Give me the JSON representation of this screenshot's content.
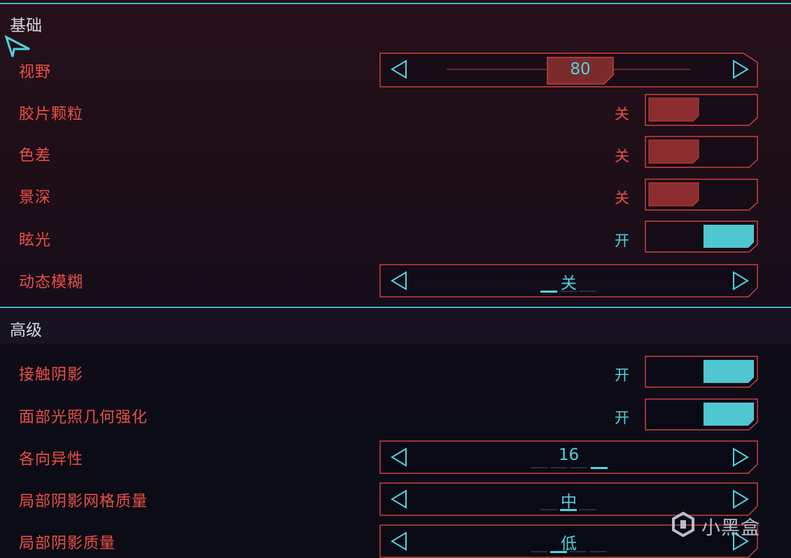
{
  "colors": {
    "accent_cyan": "#4fd3de",
    "accent_red": "#ea4f45",
    "off_fill": "#8c2c2f",
    "frame": "#c9403c"
  },
  "sections": {
    "basic": {
      "title": "基础"
    },
    "advanced": {
      "title": "高级"
    }
  },
  "settings": {
    "fov": {
      "label": "视野",
      "value": "80",
      "level_fraction": 0.45
    },
    "film_grain": {
      "label": "胶片颗粒",
      "state": "关",
      "on": false
    },
    "chromatic_aberration": {
      "label": "色差",
      "state": "关",
      "on": false
    },
    "depth_of_field": {
      "label": "景深",
      "state": "关",
      "on": false
    },
    "lens_flare": {
      "label": "眩光",
      "state": "开",
      "on": true
    },
    "motion_blur": {
      "label": "动态模糊",
      "value": "关",
      "option_count": 3,
      "selected_index": 0
    },
    "contact_shadows": {
      "label": "接触阴影",
      "state": "开",
      "on": true
    },
    "face_lighting": {
      "label": "面部光照几何强化",
      "state": "开",
      "on": true
    },
    "anisotropy": {
      "label": "各向异性",
      "value": "16",
      "option_count": 5,
      "selected_index": 4
    },
    "local_shadow_mesh": {
      "label": "局部阴影网格质量",
      "value": "中",
      "option_count": 3,
      "selected_index": 1
    },
    "local_shadow_quality": {
      "label": "局部阴影质量",
      "value": "低",
      "option_count": 4,
      "selected_index": 1
    }
  },
  "watermark": {
    "text": "小黑盒",
    "icon": "heybox-logo-icon"
  }
}
